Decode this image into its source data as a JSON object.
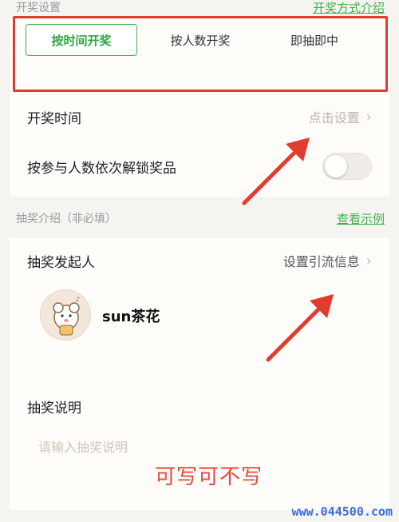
{
  "draw_section": {
    "title": "开奖设置",
    "link": "开奖方式介绍"
  },
  "draw_modes": [
    {
      "label": "按时间开奖",
      "active": true
    },
    {
      "label": "按人数开奖",
      "active": false
    },
    {
      "label": "即抽即中",
      "active": false
    }
  ],
  "draw_time": {
    "label": "开奖时间",
    "value": "点击设置"
  },
  "unlock_prizes": {
    "label": "按参与人数依次解锁奖品",
    "enabled": false
  },
  "intro_section": {
    "title": "抽奖介绍（非必填）",
    "link": "查看示例"
  },
  "initiator": {
    "label": "抽奖发起人",
    "value": "设置引流信息"
  },
  "user": {
    "name": "sun茶花"
  },
  "description": {
    "label": "抽奖说明",
    "placeholder": "请输入抽奖说明"
  },
  "annotation": "可写可不写",
  "watermark": "www.044500.com",
  "colors": {
    "accent": "#3db04f",
    "highlight": "#e23b2f",
    "watermark": "#3b6fd8"
  }
}
